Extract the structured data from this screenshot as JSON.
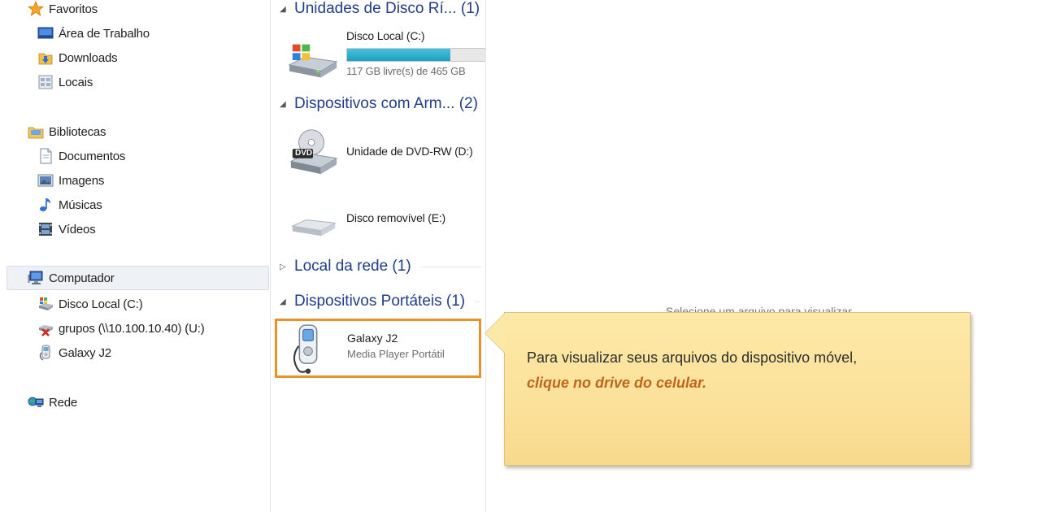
{
  "nav": {
    "favorites": "Favoritos",
    "desktop": "Área de Trabalho",
    "downloads": "Downloads",
    "places": "Locais",
    "libraries": "Bibliotecas",
    "documents": "Documentos",
    "pictures": "Imagens",
    "music": "Músicas",
    "videos": "Vídeos",
    "computer": "Computador",
    "local_disk": "Disco Local (C:)",
    "network_drive": "grupos (\\\\10.100.10.40) (U:)",
    "galaxy": "Galaxy J2",
    "network": "Rede"
  },
  "content": {
    "group_hdd": "Unidades de Disco Rí... (1)",
    "disk_c": {
      "name": "Disco Local (C:)",
      "free": "117 GB livre(s) de 465 GB",
      "used_fraction": 0.748
    },
    "group_removable": "Dispositivos com Arm... (2)",
    "dvd": {
      "name": "Unidade de DVD-RW (D:)",
      "badge": "DVD"
    },
    "removable": {
      "name": "Disco removível (E:)"
    },
    "group_network": "Local da rede (1)",
    "group_portable": "Dispositivos Portáteis (1)",
    "galaxy": {
      "name": "Galaxy J2",
      "type": "Media Player Portátil"
    }
  },
  "preview": {
    "message": "Selecione um arquivo para visualizar."
  },
  "callout": {
    "text": "Para visualizar seus arquivos do dispositivo móvel,",
    "emphasis": "clique no drive do celular."
  },
  "colors": {
    "group_header": "#1f3d8c",
    "highlight": "#e8932a",
    "callout_bg": "#fde9a7",
    "callout_emphasis": "#c0661b",
    "disk_bar": "#2aaed0"
  }
}
